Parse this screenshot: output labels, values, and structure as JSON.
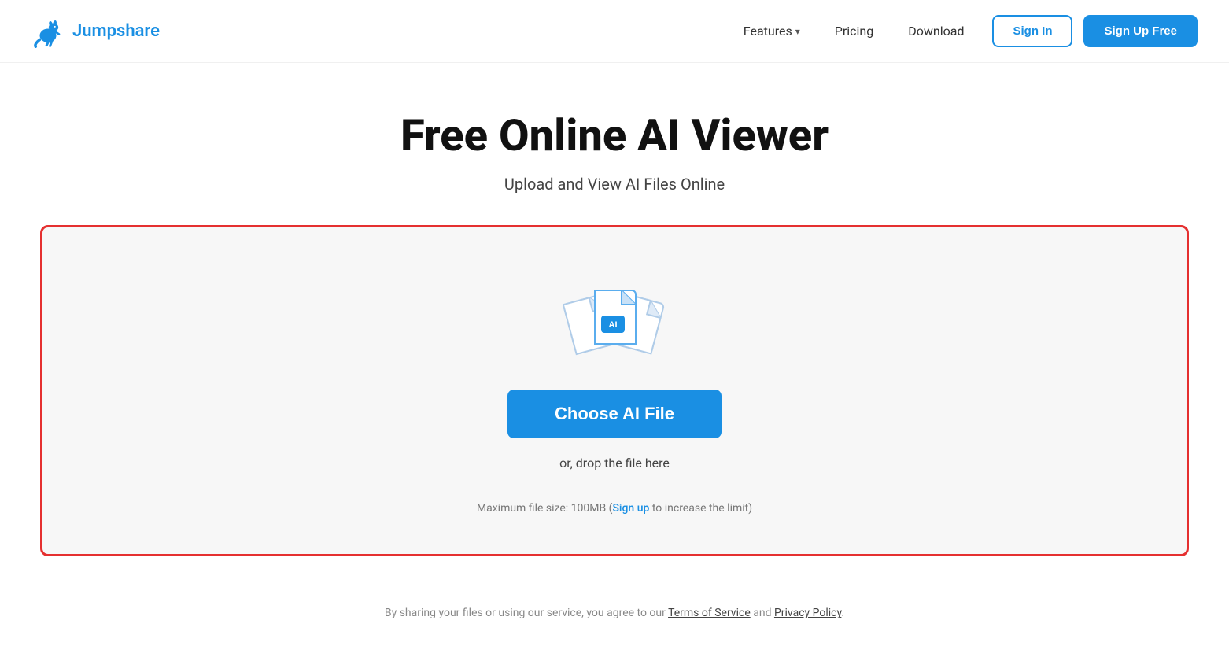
{
  "header": {
    "logo_text": "Jumpshare",
    "nav": {
      "features_label": "Features",
      "pricing_label": "Pricing",
      "download_label": "Download"
    },
    "signin_label": "Sign In",
    "signup_label": "Sign Up Free"
  },
  "hero": {
    "title": "Free Online AI Viewer",
    "subtitle": "Upload and View AI Files Online"
  },
  "dropzone": {
    "choose_button": "Choose AI File",
    "drop_hint": "or, drop the file here",
    "file_size_note_prefix": "Maximum file size: 100MB (",
    "file_size_signup_link": "Sign up",
    "file_size_note_suffix": " to increase the limit)"
  },
  "footer": {
    "text_prefix": "By sharing your files or using our service, you agree to our ",
    "terms_label": "Terms of Service",
    "text_and": " and ",
    "privacy_label": "Privacy Policy",
    "text_suffix": "."
  }
}
